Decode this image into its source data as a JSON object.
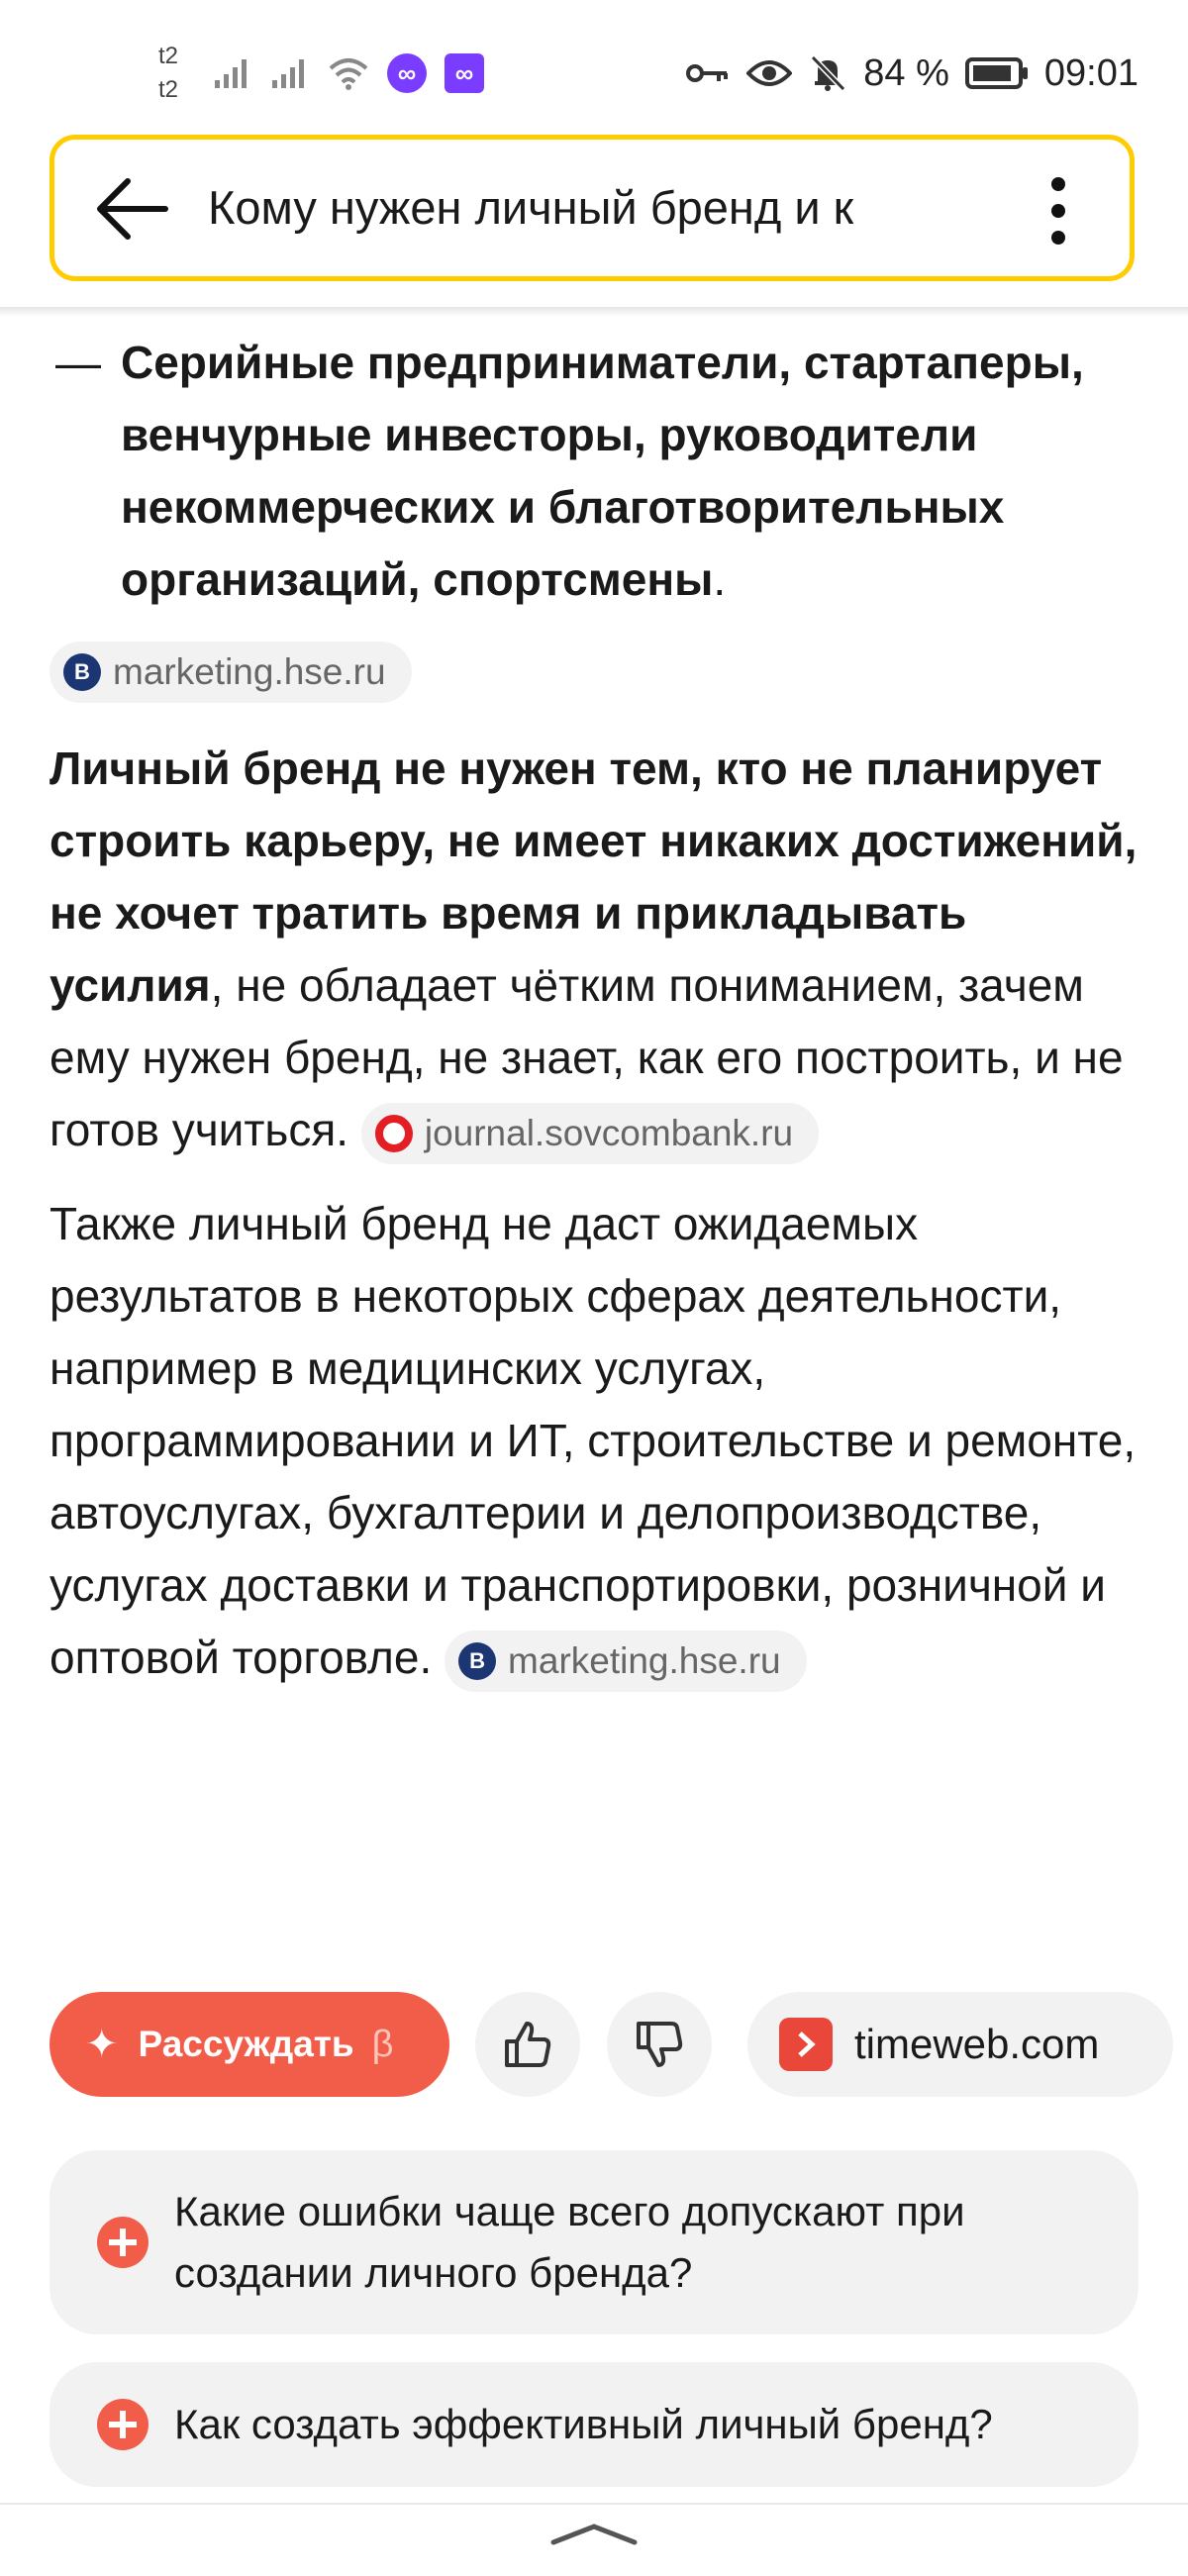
{
  "status_bar": {
    "sim1": "t2",
    "sim2": "t2",
    "app_icon_1": "link-app-icon",
    "app_icon_2": "link-app-icon",
    "battery_percent": "84 %",
    "time": "09:01"
  },
  "search": {
    "query": "Кому нужен личный бренд и к"
  },
  "content": {
    "list_item": {
      "dash": "—",
      "bold_text": "Серийные предприниматели, стартаперы, венчурные инвесторы, руководители некоммерческих и благотворительных организаций, спортсмены",
      "tail": "."
    },
    "source_1": "marketing.hse.ru",
    "para_1": {
      "bold_text": "Личный бренд не нужен тем, кто не планирует строить карьеру, не имеет никаких достижений, не хочет тратить время и прикладывать усилия",
      "text": ", не обладает чётким пониманием, зачем ему нужен бренд, не знает, как его построить, и не готов учиться.",
      "source": "journal.sovcombank.ru"
    },
    "para_2": {
      "text": "Также личный бренд не даст ожидаемых результатов в некоторых сферах деятельности, например в медицинских услугах, программировании и ИТ, строительстве и ремонте, автоуслугах, бухгалтерии и делопроизводстве, услугах доставки и транспортировки, розничной и оптовой торговле.",
      "source": "marketing.hse.ru"
    }
  },
  "actions": {
    "reason_label": "Рассуждать",
    "reason_beta": "β",
    "site_label": "timeweb.com"
  },
  "suggestions": [
    "Какие ошибки чаще всего допускают при создании личного бренда?",
    "Как создать эффективный личный бренд?"
  ],
  "colors": {
    "accent": "#f25d4a",
    "search_border": "#ffcc00",
    "chip_bg": "#f2f2f2"
  }
}
